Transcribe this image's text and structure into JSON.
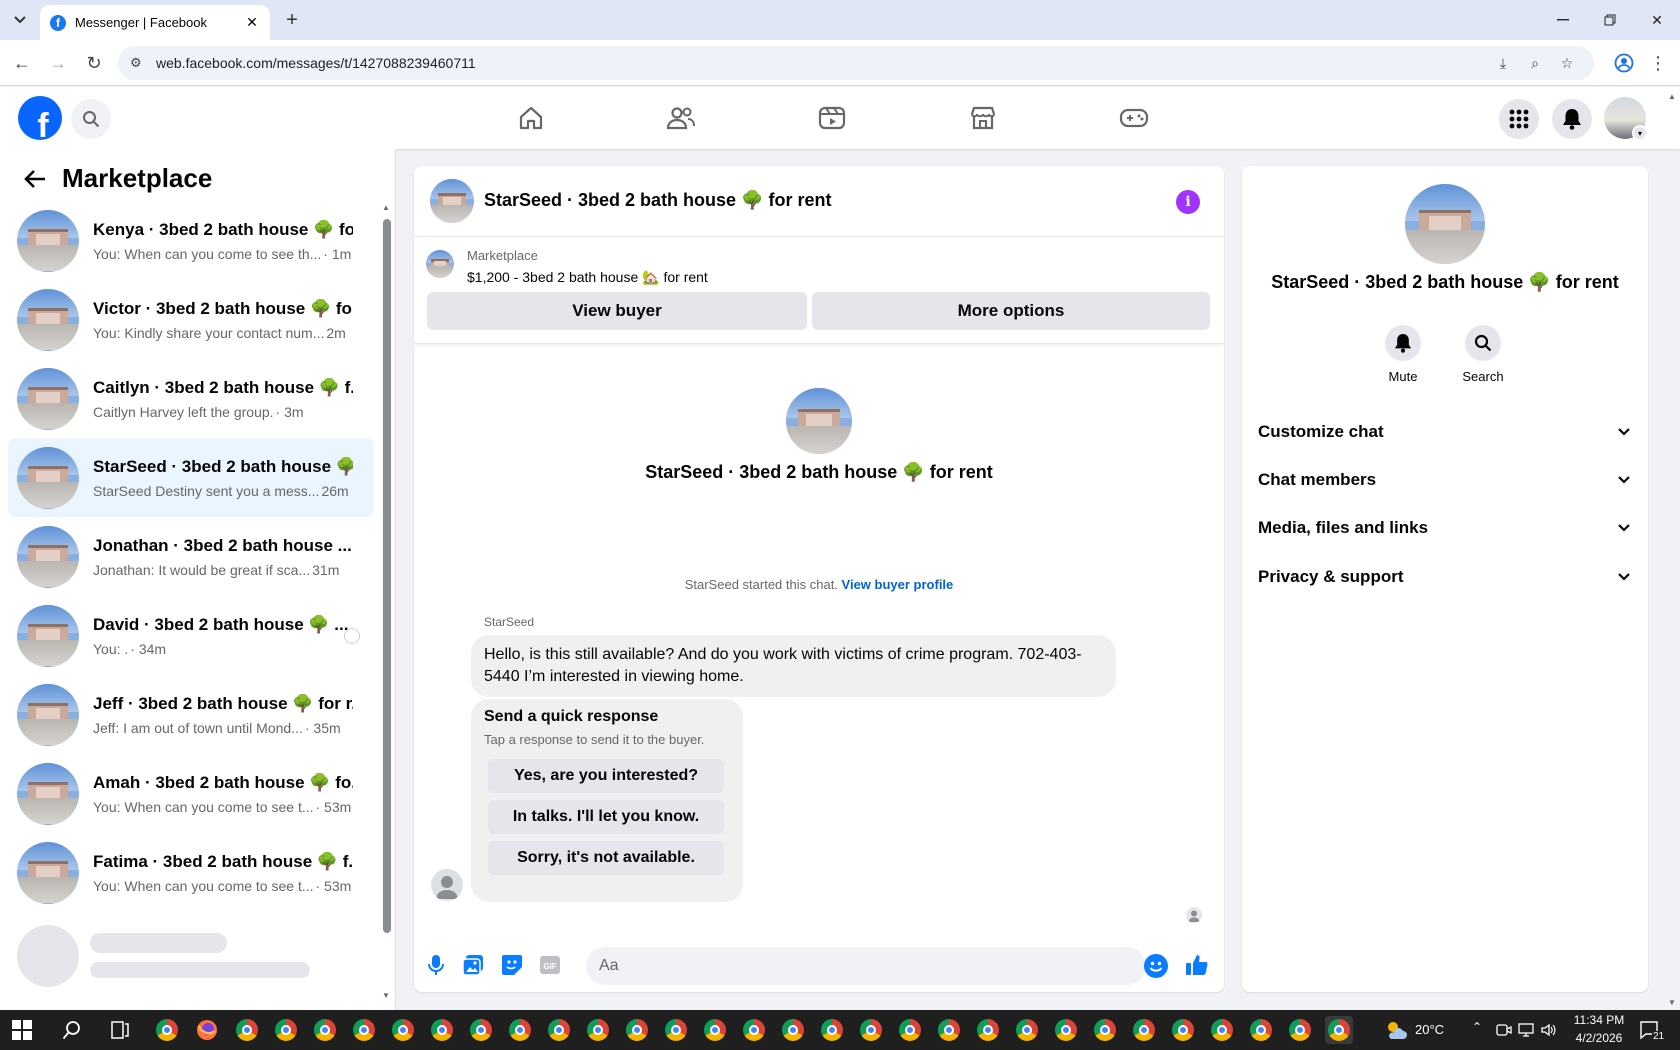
{
  "browser": {
    "tab_title": "Messenger | Facebook",
    "url": "web.facebook.com/messages/t/1427088239460711"
  },
  "sidebar": {
    "title": "Marketplace",
    "conversations": [
      {
        "name": "Kenya · 3bed 2 bath house 🌳 fo...",
        "preview": "You: When can you come to see th...",
        "time": " · 1m",
        "active": false
      },
      {
        "name": "Victor · 3bed 2 bath house 🌳 fo...",
        "preview": "You: Kindly share your contact num...",
        "time": " 2m",
        "active": false
      },
      {
        "name": "Caitlyn · 3bed 2 bath house 🌳 f...",
        "preview": "Caitlyn Harvey left the group.",
        "time": " · 3m",
        "active": false
      },
      {
        "name": "StarSeed · 3bed 2 bath house 🌳...",
        "preview": "StarSeed Destiny sent you a mess...",
        "time": " 26m",
        "active": true
      },
      {
        "name": "Jonathan · 3bed 2 bath house ...",
        "preview": "Jonathan: It would be great if sca...",
        "time": " 31m",
        "active": false
      },
      {
        "name": "David · 3bed 2 bath house 🌳 ...",
        "preview": "You: .",
        "time": " · 34m",
        "active": false
      },
      {
        "name": "Jeff · 3bed 2 bath house 🌳 for r...",
        "preview": "Jeff: I am out of town until Mond...",
        "time": " · 35m",
        "active": false
      },
      {
        "name": "Amah · 3bed 2 bath house 🌳 fo...",
        "preview": "You: When can you come to see t...",
        "time": " · 53m",
        "active": false
      },
      {
        "name": "Fatima · 3bed 2 bath house 🌳 f...",
        "preview": "You: When can you come to see t...",
        "time": " · 53m",
        "active": false
      }
    ]
  },
  "chat": {
    "title": "StarSeed · 3bed 2 bath house 🌳 for rent",
    "listing_label": "Marketplace",
    "listing_price": "$1,200 - 3bed 2 bath house 🏡 for rent",
    "view_buyer_label": "View buyer",
    "more_options_label": "More options",
    "intro_title": "StarSeed · 3bed 2 bath house 🌳 for rent",
    "started_text": "StarSeed started this chat. ",
    "view_buyer_profile": "View buyer profile",
    "sender_name": "StarSeed",
    "message": "Hello, is this still available? And do you work with victims of crime program. 702-403-5440 I’m interested in viewing home.",
    "quick_title": "Send a quick response",
    "quick_sub": "Tap a response to send it to the buyer.",
    "quick_options": [
      "Yes, are you interested?",
      "In talks. I'll let you know.",
      "Sorry, it's not available."
    ],
    "composer_placeholder": "Aa"
  },
  "info_panel": {
    "title": "StarSeed · 3bed 2 bath house 🌳 for rent",
    "mute_label": "Mute",
    "search_label": "Search",
    "sections": [
      "Customize chat",
      "Chat members",
      "Media, files and links",
      "Privacy & support"
    ]
  },
  "taskbar": {
    "weather": "20°C",
    "time": "11:34 PM",
    "date": "4/2/2026",
    "notifications": "21"
  },
  "colors": {
    "facebook_blue": "#0866ff",
    "messenger_blue": "#0a7cff",
    "info_purple": "#a033ff",
    "active_row": "#ebf5ff"
  }
}
